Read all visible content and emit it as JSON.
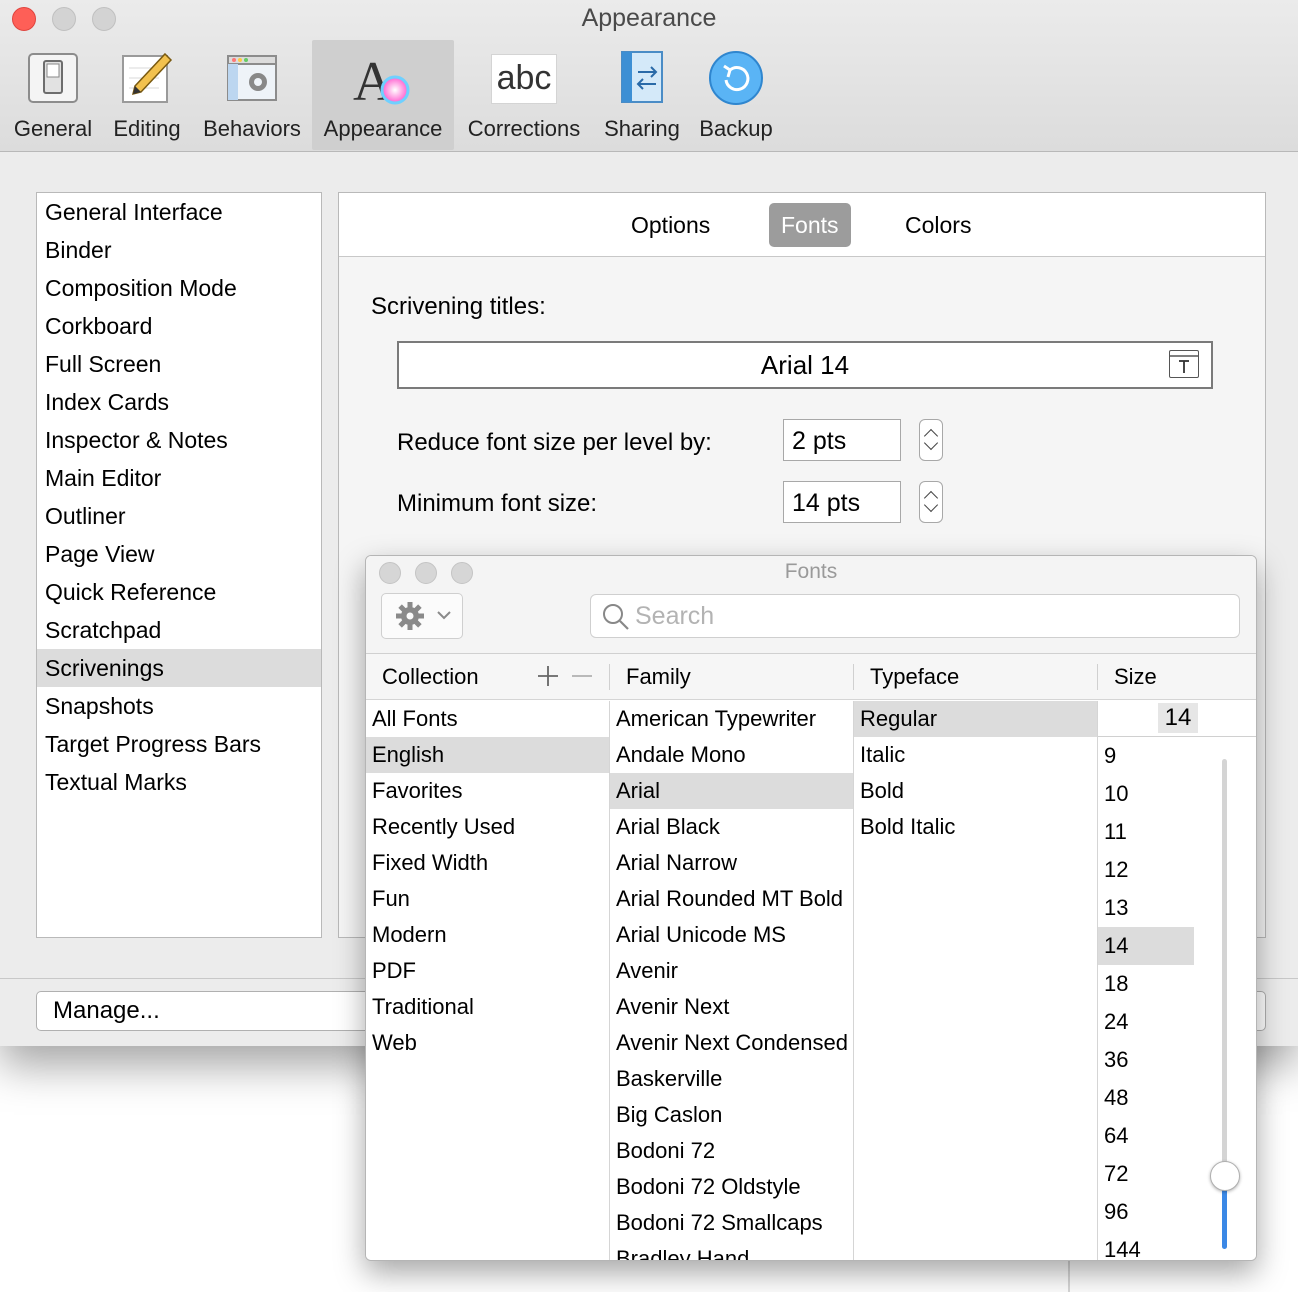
{
  "window": {
    "title": "Appearance"
  },
  "toolbar": {
    "items": [
      {
        "label": "General",
        "icon": "switch-panel-icon"
      },
      {
        "label": "Editing",
        "icon": "pencil-icon"
      },
      {
        "label": "Behaviors",
        "icon": "gear-window-icon"
      },
      {
        "label": "Appearance",
        "icon": "font-color-icon"
      },
      {
        "label": "Corrections",
        "icon": "abc-icon"
      },
      {
        "label": "Sharing",
        "icon": "sharing-arrows-icon"
      },
      {
        "label": "Backup",
        "icon": "backup-icon"
      }
    ],
    "selected": "Appearance",
    "abc_text": "abc"
  },
  "sidebar": {
    "items": [
      "General Interface",
      "Binder",
      "Composition Mode",
      "Corkboard",
      "Full Screen",
      "Index Cards",
      "Inspector & Notes",
      "Main Editor",
      "Outliner",
      "Page View",
      "Quick Reference",
      "Scratchpad",
      "Scrivenings",
      "Snapshots",
      "Target Progress Bars",
      "Textual Marks"
    ],
    "selected": "Scrivenings"
  },
  "tabs": {
    "items": [
      "Options",
      "Fonts",
      "Colors"
    ],
    "selected": "Fonts"
  },
  "fonts_tab": {
    "scrivening_titles_label": "Scrivening titles:",
    "font_well_value": "Arial 14",
    "reduce_label": "Reduce font size per level by:",
    "reduce_value": "2 pts",
    "min_label": "Minimum font size:",
    "min_value": "14 pts"
  },
  "bottom": {
    "manage_label": "Manage..."
  },
  "fonts_panel": {
    "title": "Fonts",
    "search_placeholder": "Search",
    "headers": {
      "collection": "Collection",
      "family": "Family",
      "typeface": "Typeface",
      "size": "Size"
    },
    "collections": [
      "All Fonts",
      "English",
      "Favorites",
      "Recently Used",
      "Fixed Width",
      "Fun",
      "Modern",
      "PDF",
      "Traditional",
      "Web"
    ],
    "selected_collection": "English",
    "families": [
      "American Typewriter",
      "Andale Mono",
      "Arial",
      "Arial Black",
      "Arial Narrow",
      "Arial Rounded MT Bold",
      "Arial Unicode MS",
      "Avenir",
      "Avenir Next",
      "Avenir Next Condensed",
      "Baskerville",
      "Big Caslon",
      "Bodoni 72",
      "Bodoni 72 Oldstyle",
      "Bodoni 72 Smallcaps",
      "Bradley Hand"
    ],
    "selected_family": "Arial",
    "typefaces": [
      "Regular",
      "Italic",
      "Bold",
      "Bold Italic"
    ],
    "selected_typeface": "Regular",
    "size_value": "14",
    "sizes": [
      "9",
      "10",
      "11",
      "12",
      "13",
      "14",
      "18",
      "24",
      "36",
      "48",
      "64",
      "72",
      "96",
      "144"
    ],
    "selected_size": "14",
    "size_slider_fraction": 0.15
  },
  "colors": {
    "close": "#fe5f57",
    "disabled_light": "#d3d3d3",
    "accent": "#3b88e6",
    "backup_blue": "#5ab4f5"
  }
}
